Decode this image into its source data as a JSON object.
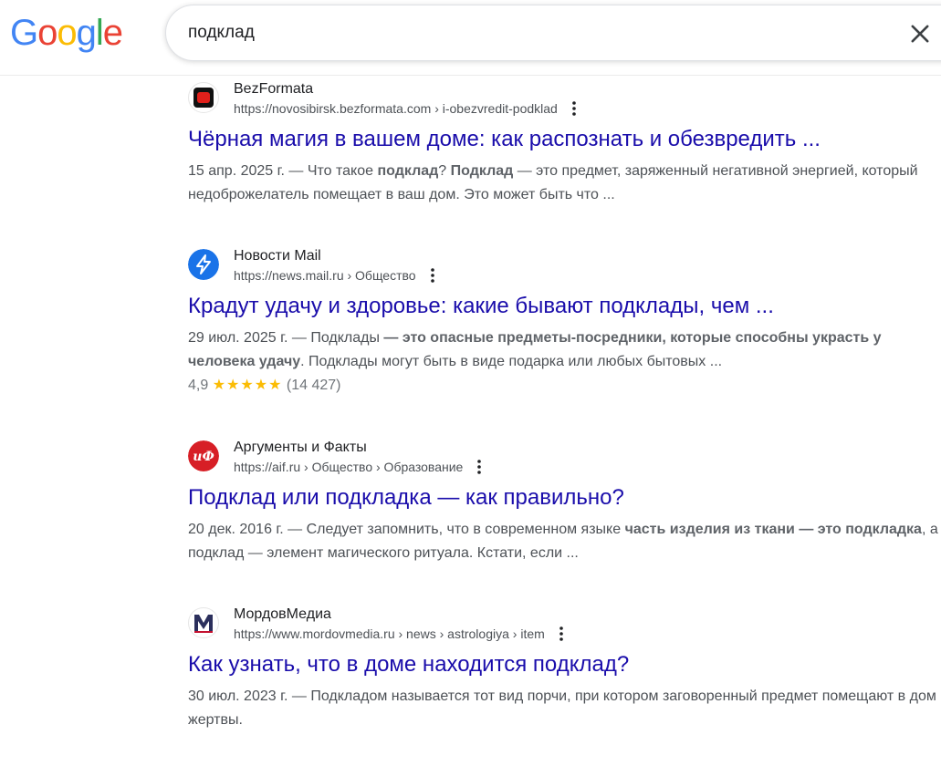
{
  "logo": {
    "letters": [
      "G",
      "o",
      "o",
      "g",
      "l",
      "e"
    ],
    "colors": [
      "#4285f4",
      "#ea4335",
      "#fbbc05",
      "#4285f4",
      "#34a853",
      "#ea4335"
    ]
  },
  "search": {
    "query": "подклад"
  },
  "results": [
    {
      "site": "BezFormata",
      "url": "https://novosibirsk.bezformata.com › i-obezvredit-podklad",
      "title": "Чёрная магия в вашем доме: как распознать и обезвредить ...",
      "snippet": [
        {
          "t": "15 апр. 2025 г. — Что такое ",
          "b": false
        },
        {
          "t": "подклад",
          "b": true
        },
        {
          "t": "? ",
          "b": false
        },
        {
          "t": "Подклад",
          "b": true
        },
        {
          "t": " — это предмет, заряженный негативной энергией, который недоброжелатель помещает в ваш дом. Это может быть что ...",
          "b": false
        }
      ]
    },
    {
      "site": "Новости Mail",
      "url": "https://news.mail.ru › Общество",
      "title": "Крадут удачу и здоровье: какие бывают подклады, чем ...",
      "snippet": [
        {
          "t": "29 июл. 2025 г. — Подклады ",
          "b": false
        },
        {
          "t": "— это опасные предметы-посредники, которые способны украсть у человека удачу",
          "b": true
        },
        {
          "t": ". Подклады могут быть в виде подарка или любых бытовых ...",
          "b": false
        }
      ],
      "rating": {
        "value": "4,9",
        "stars": "★★★★★",
        "count": "(14 427)"
      }
    },
    {
      "site": "Аргументы и Факты",
      "url": "https://aif.ru › Общество › Образование",
      "title": "Подклад или подкладка — как правильно?",
      "snippet": [
        {
          "t": "20 дек. 2016 г. — Следует запомнить, что в современном языке ",
          "b": false
        },
        {
          "t": "часть изделия из ткани — это подкладка",
          "b": true
        },
        {
          "t": ", а подклад — элемент магического ритуала. Кстати, если ...",
          "b": false
        }
      ]
    },
    {
      "site": "МордовМедиа",
      "url": "https://www.mordovmedia.ru › news › astrologiya › item",
      "title": "Как узнать, что в доме находится подклад?",
      "snippet": [
        {
          "t": "30 июл. 2023 г. — Подкладом называется тот вид порчи, при котором заговоренный предмет помещают в дом жертвы.",
          "b": false
        }
      ]
    }
  ],
  "favicons": {
    "bezformata": {
      "icon": "bezformata-icon",
      "color": "#e0201b"
    },
    "mail": {
      "icon": "lightning-icon",
      "color": "#1a73e8"
    },
    "aif": {
      "icon": "aif-logo-icon",
      "color": "#d71f26",
      "text": "иФ"
    },
    "mordovmedia": {
      "icon": "mordovmedia-logo-icon",
      "color": "#c41230",
      "text": "M"
    }
  }
}
